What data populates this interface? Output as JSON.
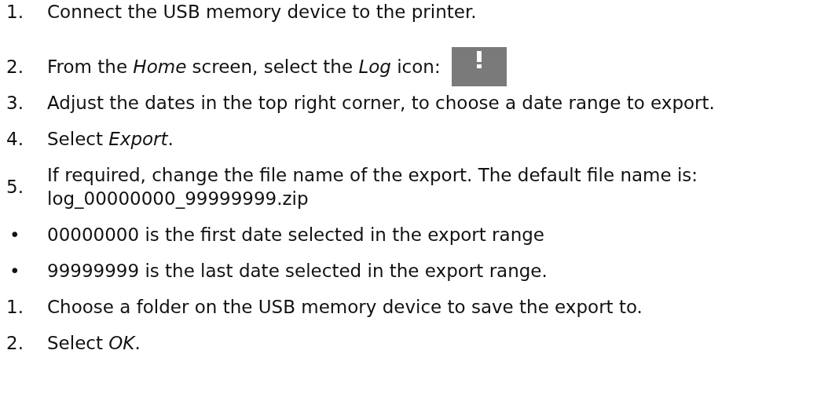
{
  "steps": [
    {
      "kind": "number",
      "marker": "1.",
      "text": "Connect the USB memory device to the printer."
    },
    {
      "kind": "number_icon",
      "marker": "2.",
      "text": "From the *Home* screen, select the *Log* icon:"
    },
    {
      "kind": "number",
      "marker": "3.",
      "text": "Adjust the dates in the top right corner, to choose a date range to export."
    },
    {
      "kind": "number",
      "marker": "4.",
      "text": "Select *Export*."
    },
    {
      "kind": "number",
      "marker": "5.",
      "text": "If required, change the file name of the export. The default file name is: log_00000000_99999999.zip"
    },
    {
      "kind": "bullet",
      "marker": "•",
      "text": "00000000 is the first date selected in the export range"
    },
    {
      "kind": "bullet",
      "marker": "•",
      "text": "99999999 is the last date selected in the export range."
    },
    {
      "kind": "number",
      "marker": "1.",
      "text": "Choose a folder on the USB memory device to save the export to."
    },
    {
      "kind": "number",
      "marker": "2.",
      "text": "Select *OK*."
    }
  ]
}
